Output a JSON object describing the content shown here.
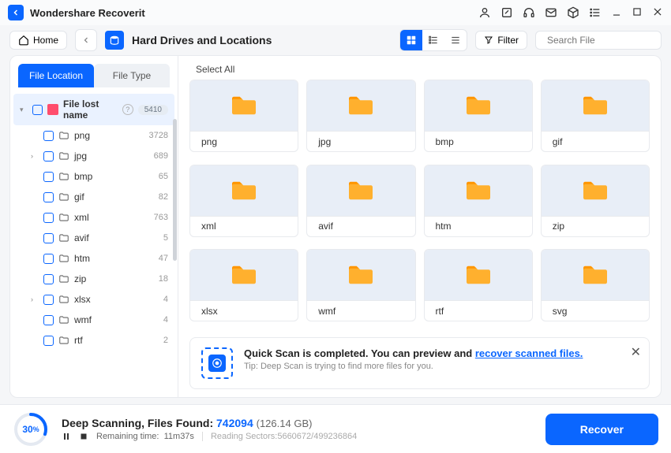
{
  "app_title": "Wondershare Recoverit",
  "toolbar": {
    "home": "Home",
    "location": "Hard Drives and Locations",
    "filter": "Filter",
    "search_placeholder": "Search File"
  },
  "sidebar": {
    "tabs": {
      "location": "File Location",
      "type": "File Type"
    },
    "root": {
      "label": "File lost name",
      "count": "5410"
    },
    "items": [
      {
        "label": "png",
        "count": "3728",
        "caret": ""
      },
      {
        "label": "jpg",
        "count": "689",
        "caret": "›"
      },
      {
        "label": "bmp",
        "count": "65",
        "caret": ""
      },
      {
        "label": "gif",
        "count": "82",
        "caret": ""
      },
      {
        "label": "xml",
        "count": "763",
        "caret": ""
      },
      {
        "label": "avif",
        "count": "5",
        "caret": ""
      },
      {
        "label": "htm",
        "count": "47",
        "caret": ""
      },
      {
        "label": "zip",
        "count": "18",
        "caret": ""
      },
      {
        "label": "xlsx",
        "count": "4",
        "caret": "›"
      },
      {
        "label": "wmf",
        "count": "4",
        "caret": ""
      },
      {
        "label": "rtf",
        "count": "2",
        "caret": ""
      }
    ]
  },
  "content": {
    "select_all": "Select All",
    "folders": [
      "png",
      "jpg",
      "bmp",
      "gif",
      "xml",
      "avif",
      "htm",
      "zip",
      "xlsx",
      "wmf",
      "rtf",
      "svg"
    ]
  },
  "notification": {
    "title_prefix": "Quick Scan is completed. You can preview and ",
    "title_link": "recover scanned files.",
    "tip": "Tip: Deep Scan is trying to find more files for you."
  },
  "status": {
    "percent": "30",
    "percent_suffix": "%",
    "scanning_label": "Deep Scanning, Files Found: ",
    "files_found": "742094",
    "size": "(126.14 GB)",
    "remaining_label": "Remaining time:",
    "remaining_value": "11m37s",
    "sectors_label": "Reading Sectors:",
    "sectors_value": "5660672/499236864",
    "recover": "Recover"
  }
}
